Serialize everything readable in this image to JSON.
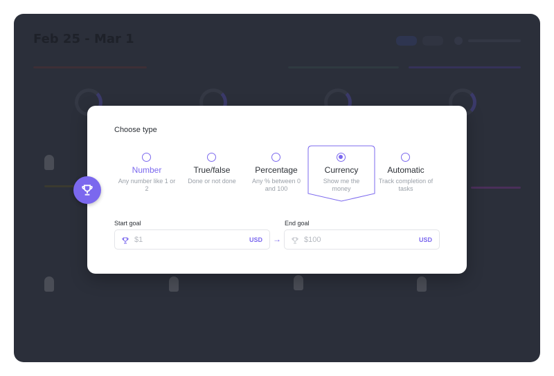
{
  "background": {
    "date_range": "Feb 25 - Mar 1"
  },
  "modal": {
    "title": "Choose type",
    "types": [
      {
        "label": "Number",
        "description": "Any number like 1 or 2",
        "selected": false,
        "active": true
      },
      {
        "label": "True/false",
        "description": "Done or not done",
        "selected": false,
        "active": false
      },
      {
        "label": "Percentage",
        "description": "Any % between 0 and 100",
        "selected": false,
        "active": false
      },
      {
        "label": "Currency",
        "description": "Show me the money",
        "selected": true,
        "active": false
      },
      {
        "label": "Automatic",
        "description": "Track completion of tasks",
        "selected": false,
        "active": false
      }
    ],
    "start_goal": {
      "label": "Start goal",
      "value": "$1",
      "currency": "USD",
      "icon": "trophy-icon"
    },
    "end_goal": {
      "label": "End goal",
      "value": "$100",
      "currency": "USD",
      "icon": "trophy-icon"
    }
  },
  "colors": {
    "accent": "#7b68ee",
    "overlay": "#2b2f3a"
  }
}
